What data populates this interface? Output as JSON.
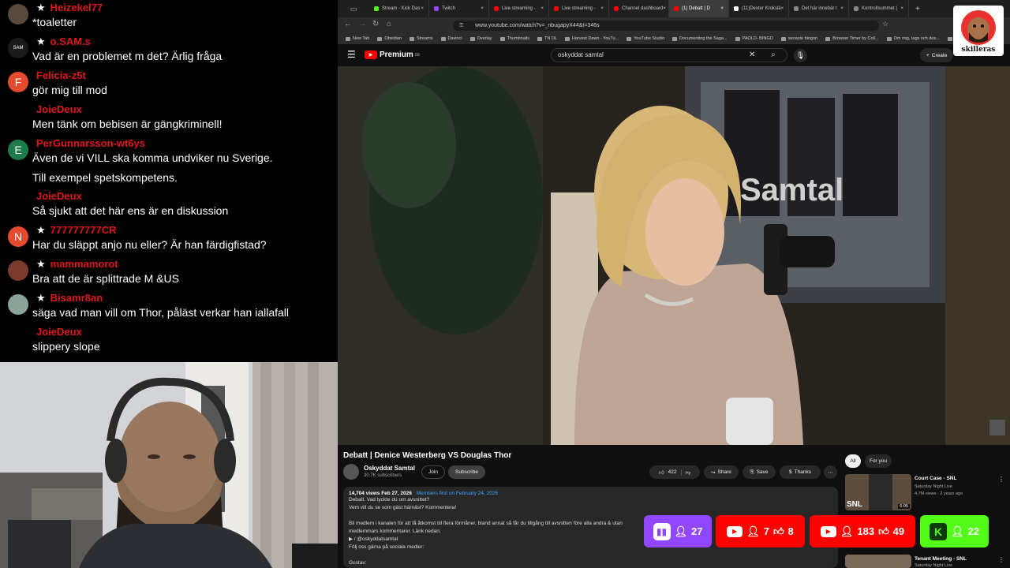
{
  "chat": {
    "messages": [
      {
        "user": "Heizekel77",
        "star": true,
        "avatar_color": "#5a4a3e",
        "avatar_letter": "",
        "text": "*toaletter"
      },
      {
        "user": "o.SAM.s",
        "star": true,
        "avatar_color": "#1a1a1a",
        "avatar_letter": "SAM",
        "text": "Vad är en problemet m det? Ärlig fråga"
      },
      {
        "user": "Felicia-z5t",
        "star": false,
        "avatar_color": "#e64a2e",
        "avatar_letter": "F",
        "text": "gör mig till mod"
      },
      {
        "user": "JoieDeux",
        "star": false,
        "avatar_color": "",
        "avatar_letter": "",
        "text": "Men tänk om bebisen är gängkriminell!"
      },
      {
        "user": "PerGunnarsson-wt6ys",
        "star": false,
        "avatar_color": "#1e7b4b",
        "avatar_letter": "E",
        "text": "Även de vi VILL ska komma undviker nu Sverige."
      },
      {
        "user": "",
        "star": false,
        "avatar_color": "",
        "avatar_letter": "",
        "text": "Till exempel spetskompetens."
      },
      {
        "user": "JoieDeux",
        "star": false,
        "avatar_color": "",
        "avatar_letter": "",
        "text": "Så sjukt att det här ens är en diskussion"
      },
      {
        "user": "777777777CR",
        "star": true,
        "avatar_color": "#e64a2e",
        "avatar_letter": "N",
        "text": "Har du släppt anjo nu eller? Är han färdigfistad?"
      },
      {
        "user": "mammamorot",
        "star": true,
        "avatar_color": "#7a3a2e",
        "avatar_letter": "",
        "text": "Bra att de är splittrade M &US"
      },
      {
        "user": "Bisamr8an",
        "star": true,
        "avatar_color": "#8aa49a",
        "avatar_letter": "",
        "text": "säga vad man vill om Thor, påläst verkar han iallafall"
      },
      {
        "user": "JoieDeux",
        "star": false,
        "avatar_color": "",
        "avatar_letter": "",
        "text": "slippery slope"
      }
    ]
  },
  "browser": {
    "tabs": [
      {
        "label": "Stream - Kick Das",
        "color": "#53fc18"
      },
      {
        "label": "Twitch",
        "color": "#9146ff"
      },
      {
        "label": "Live streaming - ",
        "color": "#ff0000"
      },
      {
        "label": "Live streaming - ",
        "color": "#ff0000"
      },
      {
        "label": "Channel dashboard",
        "color": "#ff0000"
      },
      {
        "label": "(1) Debatt | D",
        "color": "#ff0000"
      },
      {
        "label": "(11)Dexter Krokslä",
        "color": "#ffffff"
      },
      {
        "label": "Det här innebär t",
        "color": "#888888"
      },
      {
        "label": "Kontrollsummet |",
        "color": "#888888"
      }
    ],
    "url": "www.youtube.com/watch?v=_nbugapyX44&t=346s",
    "bookmarks": [
      "New Tab",
      "Obsidian",
      "Streams",
      "Davinci",
      "Overlay",
      "Thumbnails",
      "TN DL",
      "Harvest Dawn - YouTu...",
      "YouTube Studio",
      "Documenting the Saga...",
      "PAOLD- BINGO",
      "senaste bingon",
      "Browser Timer by Coll...",
      "Om mig, tags och des...",
      "You"
    ]
  },
  "youtube": {
    "logo": "Premium",
    "logo_sup": "SE",
    "search_query": "oskyddat samtal",
    "create_label": "Create",
    "video_title": "Debatt | Denice Westerberg VS Douglas Thor",
    "channel_name": "Oskyddat Samtal",
    "subscribers": "30.7K subscribers",
    "join_label": "Join",
    "subscribe_label": "Subscribe",
    "likes": "422",
    "share_label": "Share",
    "save_label": "Save",
    "thanks_label": "Thanks",
    "views": "14,704 views  Feb 27, 2026",
    "members_first": "Members first on February 24, 2026",
    "desc_lines": [
      "Debatt. Vad tyckte du om avsnittet?",
      "Vem vill du se som gäst härnäst? Kommentera!",
      "",
      "Bli medlem i kanalen för att få åtkomst till flera förmåner, bland annat så får du tillgång till avsnitten före alla andra & utan",
      "medlemmars kommentarer. Länk nedan:",
      "▶ / @oskyddatsamtal",
      "Följ oss gärna på sociala medier:",
      "",
      "Gustav:"
    ],
    "filter_all": "All",
    "filter_foryou": "For you",
    "recs": [
      {
        "title": "Court Case - SNL",
        "channel": "Saturday Night Live",
        "meta": "4.7M views · 2 years ago",
        "duration": "6:05"
      },
      {
        "title": "Tenant Meeting - SNL",
        "channel": "Saturday Night Live",
        "meta": "",
        "duration": ""
      }
    ],
    "video_logo": "Samtal"
  },
  "widgets": {
    "twitch_viewers": "27",
    "yt1_viewers": "7",
    "yt1_likes": "8",
    "yt2_viewers": "183",
    "yt2_likes": "49",
    "kick_viewers": "22",
    "kick_letter": "K"
  },
  "stream_logo": "skilleras",
  "colors": {
    "twitch": "#9146ff",
    "youtube": "#ff0000",
    "kick": "#53fc18",
    "username": "#e0161b"
  }
}
